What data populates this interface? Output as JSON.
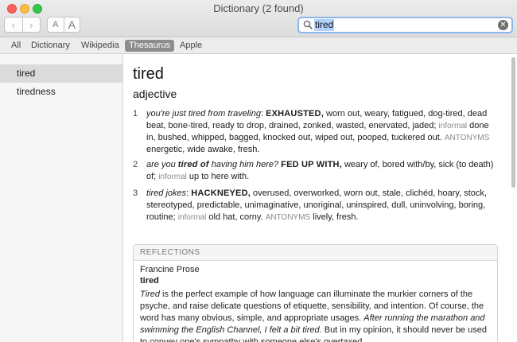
{
  "window": {
    "title": "Dictionary (2 found)"
  },
  "toolbar": {
    "back_glyph": "‹",
    "forward_glyph": "›",
    "font_small_label": "A",
    "font_large_label": "A"
  },
  "search": {
    "value": "tired",
    "clear_glyph": "✕"
  },
  "tabs": [
    {
      "label": "All",
      "active": false
    },
    {
      "label": "Dictionary",
      "active": false
    },
    {
      "label": "Wikipedia",
      "active": false
    },
    {
      "label": "Thesaurus",
      "active": true
    },
    {
      "label": "Apple",
      "active": false
    }
  ],
  "sidebar": {
    "items": [
      {
        "label": "tired",
        "selected": true
      },
      {
        "label": "tiredness",
        "selected": false
      }
    ]
  },
  "entry": {
    "headword": "tired",
    "part_of_speech": "adjective",
    "senses": [
      {
        "number": "1",
        "example": "you're just tired from traveling",
        "colon": ": ",
        "keyword": "EXHAUSTED,",
        "synonyms": " worn out, weary, fatigued, dog-tired, dead beat, bone-tired, ready to drop, drained, zonked, wasted, enervated, jaded; ",
        "label1": "informal",
        "informal": " done in, bushed, whipped, bagged, knocked out, wiped out, pooped, tuckered out. ",
        "label2": "ANTONYMS",
        "antonyms": " energetic, wide awake, fresh."
      },
      {
        "number": "2",
        "example_pre": "are you ",
        "example_word": "tired of",
        "example_post": " having him here?",
        "space": " ",
        "keyword": "FED UP WITH,",
        "synonyms": " weary of, bored with/by, sick (to death) of; ",
        "label1": "informal",
        "informal": " up to here with."
      },
      {
        "number": "3",
        "example": "tired jokes",
        "colon": ": ",
        "keyword": "HACKNEYED,",
        "synonyms": " overused, overworked, worn out, stale, clichéd, hoary, stock, stereotyped, predictable, unimaginative, unoriginal, uninspired, dull, uninvolving, boring, routine; ",
        "label1": "informal",
        "informal": " old hat, corny. ",
        "label2": "ANTONYMS",
        "antonyms": " lively, fresh."
      }
    ]
  },
  "reflections": {
    "header": "REFLECTIONS",
    "author": "Francine Prose",
    "word": "tired",
    "text_word": "Tired",
    "text_1": " is the perfect example of how language can illuminate the murkier corners of the psyche, and raise delicate questions of etiquette, sensibility, and intention. Of course, the word has many obvious, simple, and appropriate usages. ",
    "text_italic": "After running the marathon and swimming the English Channel, I felt a bit tired.",
    "text_2": " But in my opinion, it should never be used to convey one's sympathy with someone else's overtaxed"
  }
}
